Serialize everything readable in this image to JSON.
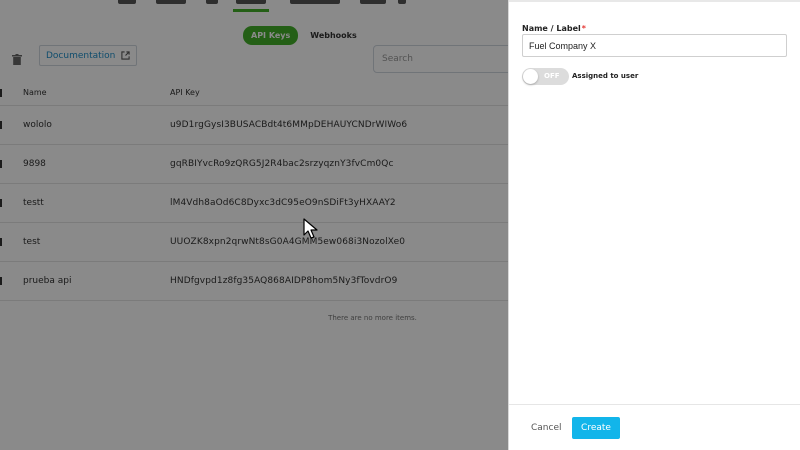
{
  "tabs": [
    {
      "label": "API Keys",
      "active": true
    },
    {
      "label": "Webhooks",
      "active": false
    }
  ],
  "toolbar": {
    "delete_icon": "trash-icon",
    "documentation_label": "Documentation",
    "documentation_icon": "external-link-icon",
    "search_placeholder": "Search"
  },
  "table": {
    "columns": [
      "Name",
      "API Key"
    ],
    "rows": [
      {
        "name": "wololo",
        "key": "u9D1rgGysI3BUSACBdt4t6MMpDEHAUYCNDrWIWo6"
      },
      {
        "name": "9898",
        "key": "gqRBIYvcRo9zQRG5J2R4bac2srzyqznY3fvCm0Qc"
      },
      {
        "name": "testt",
        "key": "lM4Vdh8aOd6C8Dyxc3dC95eO9nSDiFt3yHXAAY2"
      },
      {
        "name": "test",
        "key": "UUOZK8xpn2qrwNt8sG0A4GMM5ew068i3NozolXe0"
      },
      {
        "name": "prueba api",
        "key": "HNDfgvpd1z8fg35AQ868AIDP8hom5Ny3fTovdrO9"
      }
    ],
    "empty_message": "There are no more items."
  },
  "drawer": {
    "name_label": "Name / Label",
    "required_mark": "*",
    "name_value": "Fuel Company X",
    "toggle_state": "OFF",
    "toggle_label": "Assigned to user",
    "cancel_label": "Cancel",
    "create_label": "Create"
  },
  "colors": {
    "accent_green": "#43b02a",
    "create_blue": "#12b5ea",
    "link_blue": "#1f8fc9",
    "required_red": "#e53935"
  }
}
